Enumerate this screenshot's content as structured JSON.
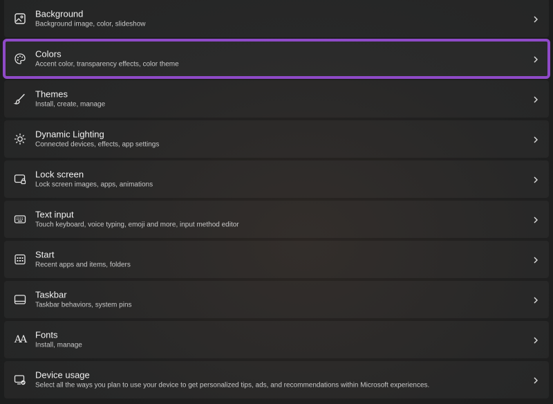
{
  "settings": {
    "items": [
      {
        "title": "Background",
        "subtitle": "Background image, color, slideshow",
        "icon": "picture-icon"
      },
      {
        "title": "Colors",
        "subtitle": "Accent color, transparency effects, color theme",
        "icon": "palette-icon"
      },
      {
        "title": "Themes",
        "subtitle": "Install, create, manage",
        "icon": "brush-icon"
      },
      {
        "title": "Dynamic Lighting",
        "subtitle": "Connected devices, effects, app settings",
        "icon": "light-icon"
      },
      {
        "title": "Lock screen",
        "subtitle": "Lock screen images, apps, animations",
        "icon": "lock-screen-icon"
      },
      {
        "title": "Text input",
        "subtitle": "Touch keyboard, voice typing, emoji and more, input method editor",
        "icon": "keyboard-icon"
      },
      {
        "title": "Start",
        "subtitle": "Recent apps and items, folders",
        "icon": "start-icon"
      },
      {
        "title": "Taskbar",
        "subtitle": "Taskbar behaviors, system pins",
        "icon": "taskbar-icon"
      },
      {
        "title": "Fonts",
        "subtitle": "Install, manage",
        "icon": "fonts-icon",
        "glyph": "AA"
      },
      {
        "title": "Device usage",
        "subtitle": "Select all the ways you plan to use your device to get personalized tips, ads, and recommendations within Microsoft experiences.",
        "icon": "device-usage-icon"
      }
    ],
    "highlight_color": "#8f4ac8"
  }
}
